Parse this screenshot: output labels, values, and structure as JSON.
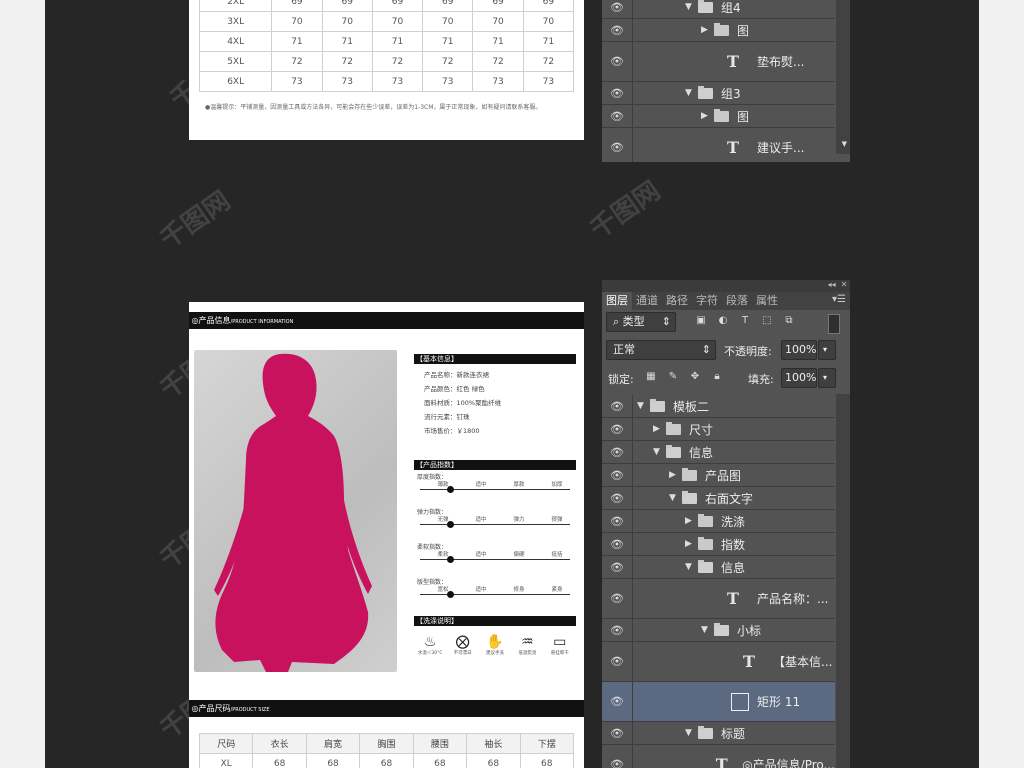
{
  "size_table_top": {
    "rows": [
      [
        "2XL",
        "69",
        "69",
        "69",
        "69",
        "69",
        "69"
      ],
      [
        "3XL",
        "70",
        "70",
        "70",
        "70",
        "70",
        "70"
      ],
      [
        "4XL",
        "71",
        "71",
        "71",
        "71",
        "71",
        "71"
      ],
      [
        "5XL",
        "72",
        "72",
        "72",
        "72",
        "72",
        "72"
      ],
      [
        "6XL",
        "73",
        "73",
        "73",
        "73",
        "73",
        "73"
      ]
    ]
  },
  "tip": "●温馨提示：平铺测量，因测量工具或方法各异，可能会存在些少误差，误差为1-3CM，属于正常现象，如有疑问请联系客服。",
  "product_info_bar": {
    "title": "◎产品信息",
    "sub": "/PRODUCT INFORMATION"
  },
  "basic_info": {
    "heading": "【基本信息】",
    "fields": [
      "产品名称：新款连衣裙",
      "产品颜色：红色 绿色",
      "面料材质：100%聚酯纤维",
      "流行元素：钉珠",
      "市场售价：￥1800"
    ]
  },
  "index": {
    "heading": "【产品指数】",
    "items": [
      {
        "label": "厚度指数：",
        "scale": [
          "薄款",
          "适中",
          "厚款",
          "加厚"
        ],
        "level": 0.1
      },
      {
        "label": "弹力指数：",
        "scale": [
          "无弹",
          "适中",
          "弹力",
          "很弹"
        ],
        "level": 0.1
      },
      {
        "label": "柔软指数：",
        "scale": [
          "柔软",
          "适中",
          "偏硬",
          "挺括"
        ],
        "level": 0.1
      },
      {
        "label": "版型指数：",
        "scale": [
          "宽松",
          "适中",
          "修身",
          "紧身"
        ],
        "level": 0.1
      }
    ]
  },
  "wash": {
    "heading": "【洗涤说明】",
    "items": [
      {
        "icon": "wash-30-icon",
        "glyph": "♨",
        "label": "水温＜30°C"
      },
      {
        "icon": "no-bleach-icon",
        "glyph": "⨂",
        "label": "不可漂白"
      },
      {
        "icon": "hand-wash-icon",
        "glyph": "✋",
        "label": "建议手洗"
      },
      {
        "icon": "low-iron-icon",
        "glyph": "♒",
        "label": "低温熨烫"
      },
      {
        "icon": "hang-dry-icon",
        "glyph": "▭",
        "label": "悬挂晾干"
      }
    ]
  },
  "size_bar": {
    "title": "◎产品尺码",
    "sub": "/PRODUCT SIZE"
  },
  "size_table_bottom": {
    "headers": [
      "尺码",
      "衣长",
      "肩宽",
      "胸围",
      "腰围",
      "袖长",
      "下摆"
    ],
    "rows": [
      [
        "XL",
        "68",
        "68",
        "68",
        "68",
        "68",
        "68"
      ]
    ]
  },
  "layers_top": {
    "rows": [
      {
        "indent": 3,
        "type": "group",
        "open": true,
        "name": "组4"
      },
      {
        "indent": 4,
        "type": "group",
        "open": false,
        "name": "图"
      },
      {
        "indent": 4,
        "type": "text",
        "name": "垫布熨..."
      },
      {
        "indent": 3,
        "type": "group",
        "open": true,
        "name": "组3"
      },
      {
        "indent": 4,
        "type": "group",
        "open": false,
        "name": "图"
      },
      {
        "indent": 4,
        "type": "text",
        "name": "建议手..."
      }
    ]
  },
  "layers_panel": {
    "tabs": [
      "图层",
      "通道",
      "路径",
      "字符",
      "段落",
      "属性"
    ],
    "filter": "类型",
    "blend_mode": "正常",
    "opacity_label": "不透明度:",
    "opacity": "100%",
    "lock_label": "锁定:",
    "fill_label": "填充:",
    "fill": "100%",
    "rows": [
      {
        "indent": 0,
        "type": "group",
        "open": true,
        "name": "模板二"
      },
      {
        "indent": 1,
        "type": "group",
        "open": false,
        "name": "尺寸"
      },
      {
        "indent": 1,
        "type": "group",
        "open": true,
        "name": "信息"
      },
      {
        "indent": 2,
        "type": "group",
        "open": false,
        "name": "产品图"
      },
      {
        "indent": 2,
        "type": "group",
        "open": true,
        "name": "右面文字"
      },
      {
        "indent": 3,
        "type": "group",
        "open": false,
        "name": "洗涤"
      },
      {
        "indent": 3,
        "type": "group",
        "open": false,
        "name": "指数"
      },
      {
        "indent": 3,
        "type": "group",
        "open": true,
        "name": "信息"
      },
      {
        "indent": 4,
        "type": "text",
        "name": "产品名称：..."
      },
      {
        "indent": 4,
        "type": "group",
        "open": true,
        "name": "小标"
      },
      {
        "indent": 5,
        "type": "text",
        "name": "【基本信..."
      },
      {
        "indent": 5,
        "type": "shape",
        "name": "矩形 11",
        "selected": true
      },
      {
        "indent": 3,
        "type": "group",
        "open": true,
        "name": "标题"
      },
      {
        "indent": 4,
        "type": "text",
        "name": "◎产品信息/Pro..."
      }
    ]
  },
  "watermark": "千图网",
  "colors": {
    "dress": "#c8125e",
    "canvas": "#262626",
    "panel": "#535353",
    "selected": "#5b6a80"
  }
}
